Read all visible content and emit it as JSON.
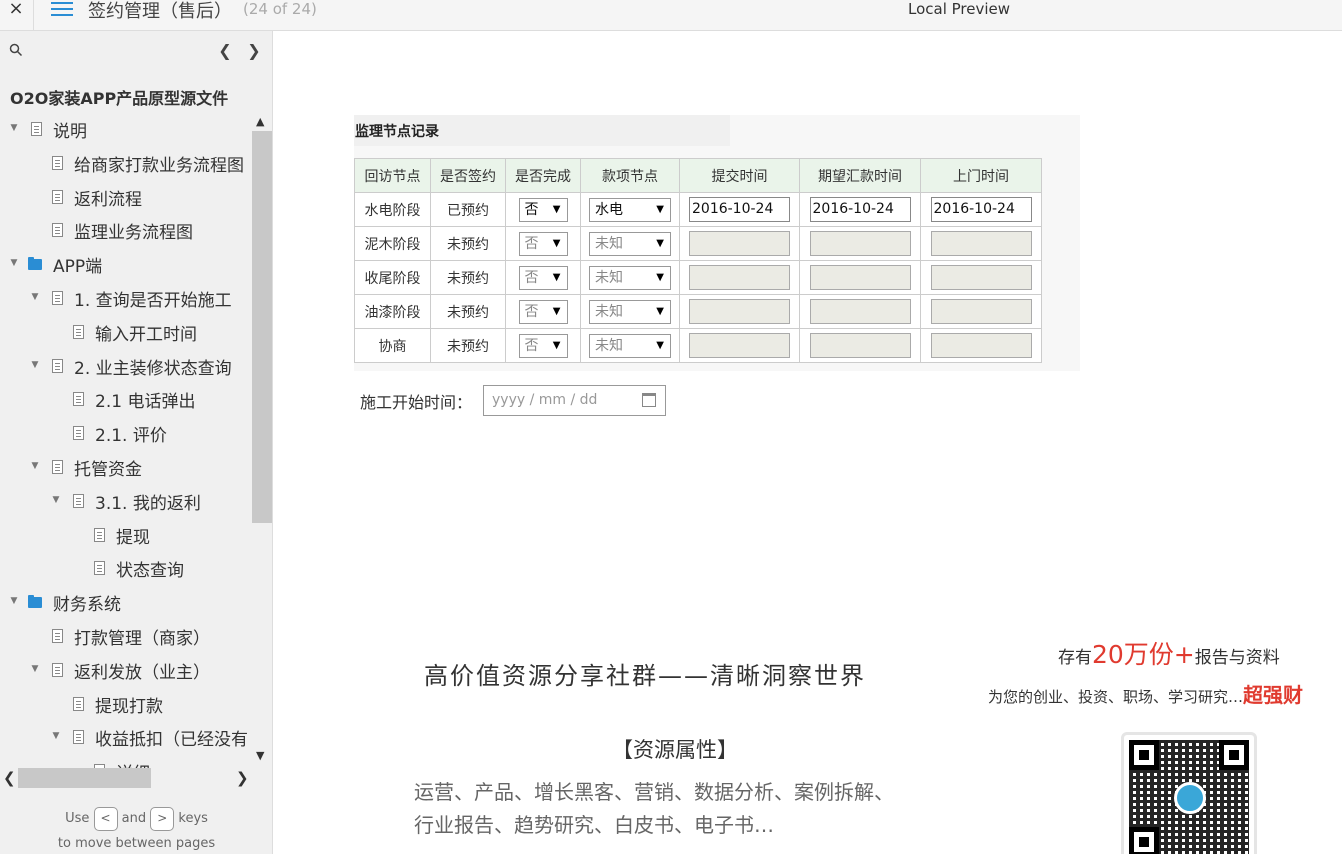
{
  "topbar": {
    "close": "×",
    "title": "签约管理（售后）",
    "page_count": "(24 of 24)",
    "preview": "Local Preview"
  },
  "sidebar": {
    "project_title": "O2O家装APP产品原型源文件",
    "items": [
      {
        "label": "说明",
        "level": 0,
        "type": "page",
        "expanded": true
      },
      {
        "label": "给商家打款业务流程图",
        "level": 1,
        "type": "page"
      },
      {
        "label": "返利流程",
        "level": 1,
        "type": "page"
      },
      {
        "label": "监理业务流程图",
        "level": 1,
        "type": "page"
      },
      {
        "label": "APP端",
        "level": 0,
        "type": "folder",
        "expanded": true
      },
      {
        "label": "1. 查询是否开始施工",
        "level": 1,
        "type": "page",
        "expanded": true
      },
      {
        "label": "输入开工时间",
        "level": 2,
        "type": "page"
      },
      {
        "label": "2. 业主装修状态查询",
        "level": 1,
        "type": "page",
        "expanded": true
      },
      {
        "label": "2.1 电话弹出",
        "level": 2,
        "type": "page"
      },
      {
        "label": "2.1. 评价",
        "level": 2,
        "type": "page"
      },
      {
        "label": "托管资金",
        "level": 1,
        "type": "page",
        "expanded": true
      },
      {
        "label": "3.1. 我的返利",
        "level": 2,
        "type": "page",
        "expanded": true
      },
      {
        "label": "提现",
        "level": 3,
        "type": "page"
      },
      {
        "label": "状态查询",
        "level": 3,
        "type": "page"
      },
      {
        "label": "财务系统",
        "level": 0,
        "type": "folder",
        "expanded": true
      },
      {
        "label": "打款管理（商家）",
        "level": 1,
        "type": "page"
      },
      {
        "label": "返利发放（业主）",
        "level": 1,
        "type": "page",
        "expanded": true
      },
      {
        "label": "提现打款",
        "level": 2,
        "type": "page"
      },
      {
        "label": "收益抵扣（已经没有",
        "level": 2,
        "type": "page",
        "expanded": true
      },
      {
        "label": "详细",
        "level": 3,
        "type": "page"
      }
    ],
    "hint": {
      "use": "Use",
      "and": "and",
      "keys": "keys",
      "line2": "to move between pages",
      "key_prev": "<",
      "key_next": ">"
    }
  },
  "main": {
    "panel_title": "监理节点记录",
    "headers": [
      "回访节点",
      "是否签约",
      "是否完成",
      "款项节点",
      "提交时间",
      "期望汇款时间",
      "上门时间"
    ],
    "rows": [
      {
        "node": "水电阶段",
        "signed": "已预约",
        "done": "否",
        "payment": "水电",
        "submit": "2016-10-24",
        "expected": "2016-10-24",
        "visit": "2016-10-24",
        "enabled": true
      },
      {
        "node": "泥木阶段",
        "signed": "未预约",
        "done": "否",
        "payment": "未知",
        "submit": "",
        "expected": "",
        "visit": "",
        "enabled": false
      },
      {
        "node": "收尾阶段",
        "signed": "未预约",
        "done": "否",
        "payment": "未知",
        "submit": "",
        "expected": "",
        "visit": "",
        "enabled": false
      },
      {
        "node": "油漆阶段",
        "signed": "未预约",
        "done": "否",
        "payment": "未知",
        "submit": "",
        "expected": "",
        "visit": "",
        "enabled": false
      },
      {
        "node": "协商",
        "signed": "未预约",
        "done": "否",
        "payment": "未知",
        "submit": "",
        "expected": "",
        "visit": "",
        "enabled": false
      }
    ],
    "start_label": "施工开始时间：",
    "start_placeholder": "yyyy / mm / dd"
  },
  "promo": {
    "title": "高价值资源分享社群——清晰洞察世界",
    "line1_pre": "存有",
    "line1_big": "20万份+",
    "line1_post": "报告与资料",
    "line2_pre": "为您的创业、投资、职场、学习研究…",
    "line2_red": "超强财",
    "attr": "【资源属性】",
    "tags1": "运营、产品、增长黑客、营销、数据分析、案例拆解、",
    "tags2": "行业报告、趋势研究、白皮书、电子书…"
  }
}
